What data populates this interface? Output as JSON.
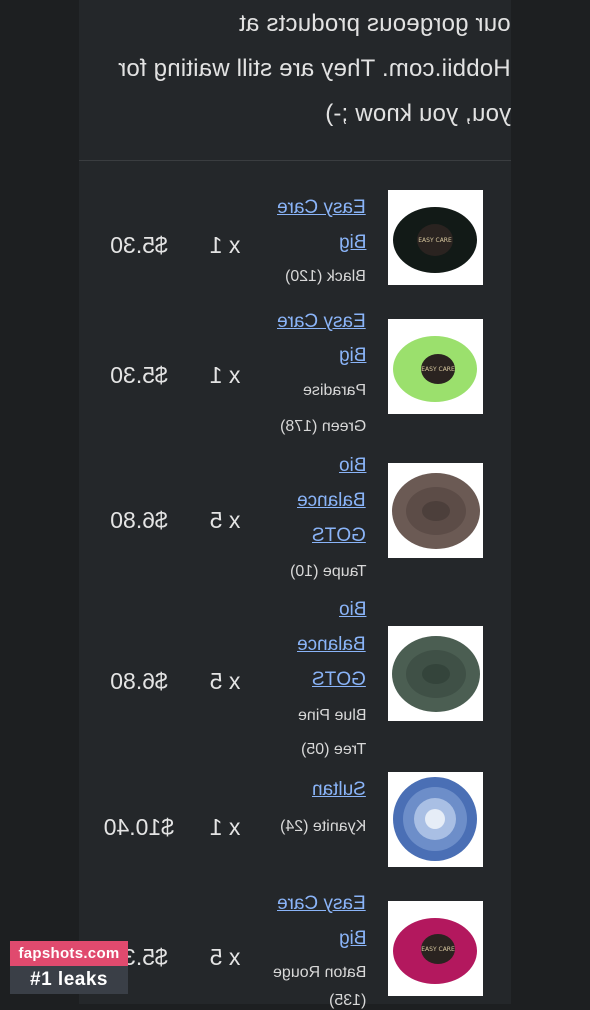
{
  "intro": {
    "lines": [
      "our gorgeous products at",
      "Hobbii.com. They are still waiting for",
      "you, you know ;-)"
    ]
  },
  "items": [
    {
      "name_lines": [
        "Easy Care",
        "Big"
      ],
      "variant_lines": [
        "Black (120)"
      ],
      "quantity": "x 1",
      "price": "$5.30",
      "yarn_color": "#121a17"
    },
    {
      "name_lines": [
        "Easy Care",
        "Big"
      ],
      "variant_lines": [
        "Paradise",
        "Green (178)"
      ],
      "quantity": "x 1",
      "price": "$5.30",
      "yarn_color": "#9be06d"
    },
    {
      "name_lines": [
        "Bio",
        "Balance",
        "GOTS"
      ],
      "variant_lines": [
        "Taupe (10)"
      ],
      "quantity": "x 5",
      "price": "$6.80",
      "yarn_color": "#6b5a54"
    },
    {
      "name_lines": [
        "Bio",
        "Balance",
        "GOTS"
      ],
      "variant_lines": [
        "Blue Pine",
        "Tree (05)"
      ],
      "quantity": "x 5",
      "price": "$6.80",
      "yarn_color": "#4b5e52"
    },
    {
      "name_lines": [
        "Sultan"
      ],
      "variant_lines": [
        "Kyanite (24)"
      ],
      "quantity": "x 1",
      "price": "$10.40",
      "yarn_color": "#6d8ec9"
    },
    {
      "name_lines": [
        "Easy Care",
        "Big"
      ],
      "variant_lines": [
        "Baton Rouge",
        "(135)"
      ],
      "quantity": "x 5",
      "price": "$5.30",
      "yarn_color": "#b3185e"
    }
  ],
  "watermark": {
    "site": "fapshots.com",
    "tagline": "#1 leaks"
  }
}
